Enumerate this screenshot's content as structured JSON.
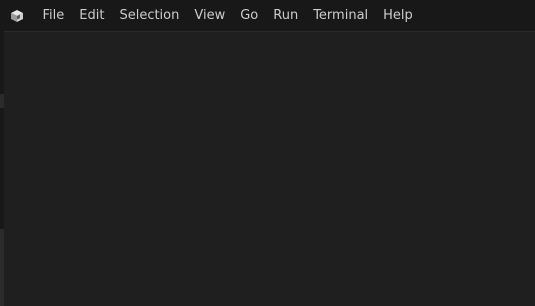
{
  "app": {
    "logo_icon": "vscode-cube-logo-icon"
  },
  "menubar": {
    "items": [
      {
        "label": "File"
      },
      {
        "label": "Edit"
      },
      {
        "label": "Selection"
      },
      {
        "label": "View"
      },
      {
        "label": "Go"
      },
      {
        "label": "Run"
      },
      {
        "label": "Terminal"
      },
      {
        "label": "Help"
      }
    ]
  },
  "colors": {
    "titlebar_bg": "#181818",
    "editor_bg": "#1f1f1f",
    "menu_text": "#cccccc"
  }
}
